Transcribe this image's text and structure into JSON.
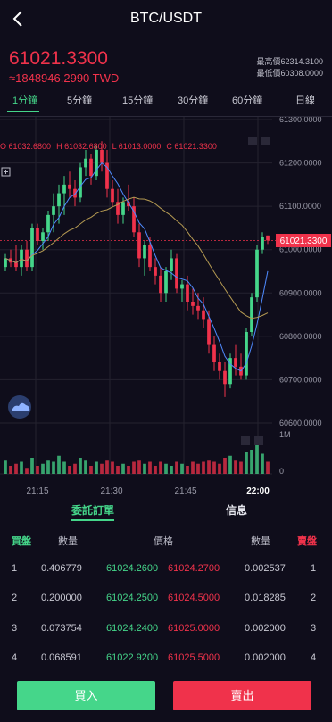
{
  "header": {
    "title": "BTC/USDT",
    "back_icon": "chevron-left-icon"
  },
  "price": {
    "last": "61021.3300",
    "fiat": "≈1848946.2990 TWD"
  },
  "high_low": {
    "high": "最高價62314.3100",
    "low": "最低價60308.0000"
  },
  "intervals": [
    "1分鐘",
    "5分鐘",
    "15分鐘",
    "30分鐘",
    "60分鐘",
    "日線"
  ],
  "ohlc": {
    "o": "O 61032.6800",
    "h": "H 61032.6800",
    "l": "L 61013.0000",
    "c": "C 61021.3300"
  },
  "y_axis": [
    "61300.0000",
    "61200.0000",
    "61100.0000",
    "61000.0000",
    "60900.0000",
    "60800.0000",
    "60700.0000",
    "60600.0000"
  ],
  "current_price_tag": "61021.3300",
  "volume_axis": [
    "1M",
    "0"
  ],
  "x_axis": [
    "21:15",
    "21:30",
    "21:45",
    "22:00"
  ],
  "chart_data": {
    "type": "candlestick",
    "ylim": [
      60600,
      61300
    ],
    "candles": [
      [
        60960,
        60990,
        60950,
        60980
      ],
      [
        60980,
        61000,
        60960,
        60970
      ],
      [
        60970,
        61010,
        60950,
        60960
      ],
      [
        60960,
        61010,
        60940,
        61000
      ],
      [
        61000,
        61020,
        60950,
        60960
      ],
      [
        60960,
        61060,
        60950,
        61050
      ],
      [
        61050,
        61060,
        61010,
        61020
      ],
      [
        61020,
        61050,
        61000,
        61040
      ],
      [
        61040,
        61090,
        61020,
        61080
      ],
      [
        61080,
        61130,
        61040,
        61100
      ],
      [
        61100,
        61150,
        61060,
        61130
      ],
      [
        61130,
        61170,
        61080,
        61150
      ],
      [
        61150,
        61180,
        61120,
        61140
      ],
      [
        61140,
        61160,
        61100,
        61120
      ],
      [
        61120,
        61200,
        61110,
        61190
      ],
      [
        61190,
        61230,
        61170,
        61210
      ],
      [
        61210,
        61220,
        61150,
        61170
      ],
      [
        61170,
        61240,
        61160,
        61230
      ],
      [
        61230,
        61250,
        61180,
        61200
      ],
      [
        61200,
        61230,
        61120,
        61140
      ],
      [
        61140,
        61160,
        61100,
        61110
      ],
      [
        61110,
        61140,
        61060,
        61080
      ],
      [
        61080,
        61120,
        61060,
        61110
      ],
      [
        61110,
        61150,
        61090,
        61100
      ],
      [
        61100,
        61120,
        61030,
        61040
      ],
      [
        61040,
        61060,
        60960,
        60980
      ],
      [
        60980,
        61020,
        60940,
        61010
      ],
      [
        61010,
        61030,
        60950,
        60960
      ],
      [
        60960,
        60980,
        60920,
        60940
      ],
      [
        60940,
        60960,
        60880,
        60900
      ],
      [
        60900,
        60960,
        60880,
        60950
      ],
      [
        60950,
        61000,
        60930,
        60980
      ],
      [
        60980,
        60990,
        60900,
        60910
      ],
      [
        60910,
        60930,
        60880,
        60920
      ],
      [
        60920,
        60940,
        60860,
        60880
      ],
      [
        60880,
        60910,
        60850,
        60870
      ],
      [
        60870,
        60900,
        60840,
        60860
      ],
      [
        60860,
        60890,
        60820,
        60840
      ],
      [
        60840,
        60860,
        60760,
        60780
      ],
      [
        60780,
        60800,
        60720,
        60740
      ],
      [
        60740,
        60760,
        60700,
        60720
      ],
      [
        60720,
        60740,
        60660,
        60690
      ],
      [
        60690,
        60760,
        60680,
        60750
      ],
      [
        60750,
        60780,
        60710,
        60730
      ],
      [
        60730,
        60760,
        60700,
        60710
      ],
      [
        60710,
        60820,
        60700,
        60810
      ],
      [
        60810,
        60900,
        60800,
        60890
      ],
      [
        60890,
        61010,
        60880,
        61000
      ],
      [
        61000,
        61040,
        60990,
        61030
      ],
      [
        61032.68,
        61032.68,
        61013,
        61021.33
      ]
    ],
    "volumes": [
      0.35,
      0.2,
      0.25,
      0.3,
      0.15,
      0.4,
      0.2,
      0.25,
      0.35,
      0.3,
      0.45,
      0.3,
      0.2,
      0.25,
      0.4,
      0.35,
      0.2,
      0.3,
      0.25,
      0.35,
      0.3,
      0.2,
      0.25,
      0.2,
      0.3,
      0.35,
      0.25,
      0.3,
      0.2,
      0.3,
      0.25,
      0.2,
      0.3,
      0.25,
      0.2,
      0.3,
      0.25,
      0.3,
      0.35,
      0.3,
      0.25,
      0.4,
      0.45,
      0.35,
      0.3,
      0.55,
      0.6,
      0.75,
      0.5,
      0.3
    ]
  },
  "orderbook": {
    "tab_orders": "委託訂單",
    "tab_info": "信息",
    "headers": {
      "buy": "買盤",
      "qty_left": "數量",
      "price": "價格",
      "qty_right": "數量",
      "sell": "賣盤"
    },
    "rows": [
      {
        "idx": "1",
        "bid_qty": "0.406779",
        "bid": "61024.2600",
        "ask": "61024.2700",
        "ask_qty": "0.002537",
        "idx2": "1"
      },
      {
        "idx": "2",
        "bid_qty": "0.200000",
        "bid": "61024.2500",
        "ask": "61024.5000",
        "ask_qty": "0.018285",
        "idx2": "2"
      },
      {
        "idx": "3",
        "bid_qty": "0.073754",
        "bid": "61024.2400",
        "ask": "61025.0000",
        "ask_qty": "0.002000",
        "idx2": "3"
      },
      {
        "idx": "4",
        "bid_qty": "0.068591",
        "bid": "61022.9200",
        "ask": "61025.5000",
        "ask_qty": "0.002000",
        "idx2": "4"
      }
    ]
  },
  "actions": {
    "buy": "買入",
    "sell": "賣出"
  },
  "colors": {
    "up": "#45d68a",
    "down": "#f0324b",
    "background": "#0f0d1b"
  }
}
